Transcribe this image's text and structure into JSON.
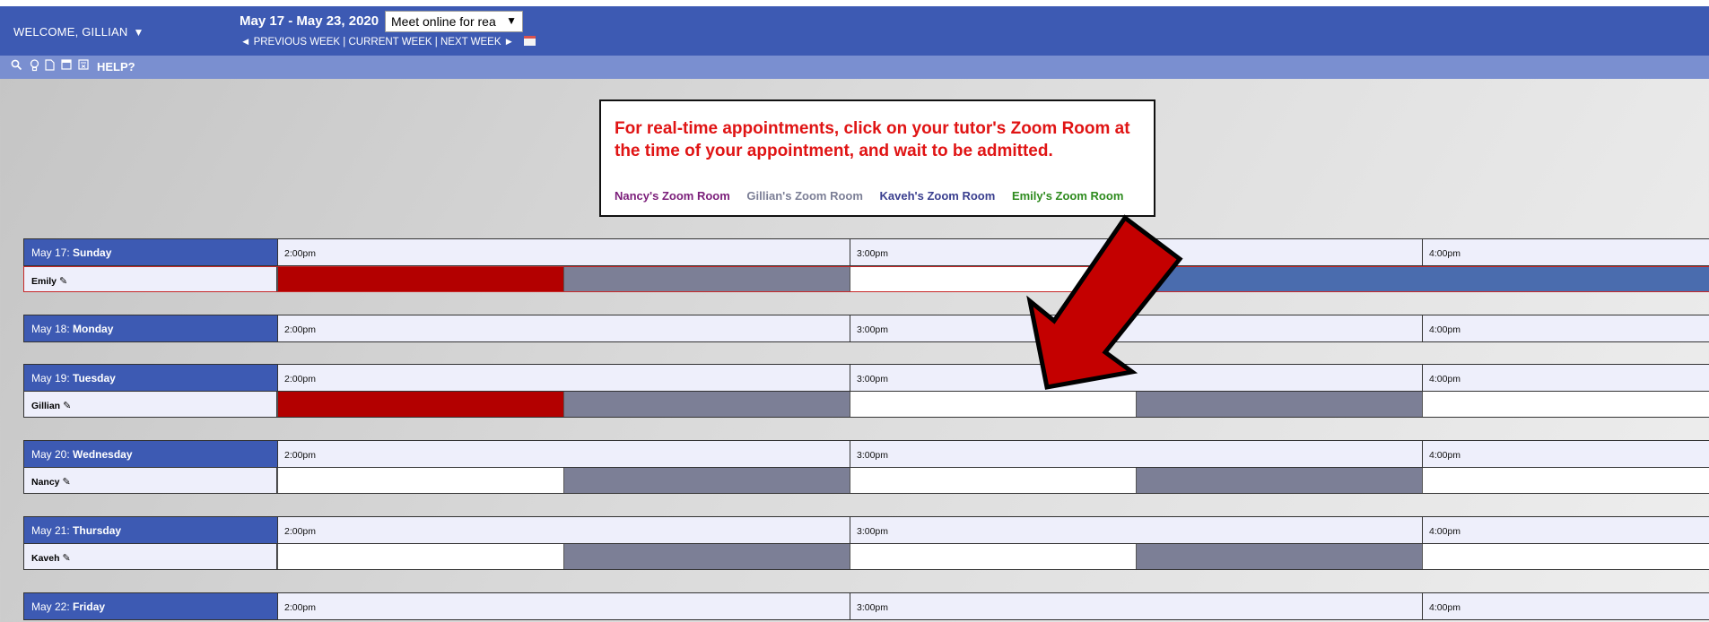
{
  "header": {
    "welcome": "WELCOME, GILLIAN",
    "welcome_caret": "▼",
    "date_range": "May 17 - May 23, 2020",
    "mode_select": "Meet online for rea",
    "mode_select_caret": "▼",
    "prev_week": "◄ PREVIOUS WEEK",
    "current_week": "CURRENT WEEK",
    "next_week": "NEXT WEEK ►",
    "separator": "|"
  },
  "toolbar": {
    "help": "HELP?",
    "icons": [
      "search-icon",
      "lightbulb-icon",
      "document-icon",
      "window-icon",
      "calculator-icon"
    ]
  },
  "notice": {
    "message": "For real-time appointments, click on your tutor's Zoom Room at the time of your appointment, and wait to be admitted.",
    "zoom_rooms": [
      {
        "label": "Nancy's Zoom Room",
        "color": "#7b1e7a"
      },
      {
        "label": "Gillian's Zoom Room",
        "color": "#7c7f96"
      },
      {
        "label": "Kaveh's Zoom Room",
        "color": "#3a3f8f"
      },
      {
        "label": "Emily's Zoom Room",
        "color": "#2e8b1e"
      }
    ]
  },
  "times": [
    "2:00pm",
    "3:00pm",
    "4:00pm"
  ],
  "colors": {
    "header": "#3d5ab3",
    "toolbar": "#7a8fd0",
    "booked": "#b30000",
    "busy": "#7c7f96",
    "open": "#ffffff",
    "highlight": "#4a6cae",
    "arrow": "#c40000"
  },
  "days": [
    {
      "date": "May 17:",
      "weekday": "Sunday",
      "tutor": "Emily",
      "slots": [
        "booked",
        "busy",
        "open",
        "blue",
        "blue"
      ]
    },
    {
      "date": "May 18:",
      "weekday": "Monday"
    },
    {
      "date": "May 19:",
      "weekday": "Tuesday",
      "tutor": "Gillian",
      "slots": [
        "booked",
        "busy",
        "open",
        "busy",
        "open"
      ]
    },
    {
      "date": "May 20:",
      "weekday": "Wednesday",
      "tutor": "Nancy",
      "slots": [
        "open",
        "busy",
        "open",
        "busy",
        "open"
      ]
    },
    {
      "date": "May 21:",
      "weekday": "Thursday",
      "tutor": "Kaveh",
      "slots": [
        "open",
        "busy",
        "open",
        "busy",
        "open"
      ]
    },
    {
      "date": "May 22:",
      "weekday": "Friday"
    }
  ]
}
